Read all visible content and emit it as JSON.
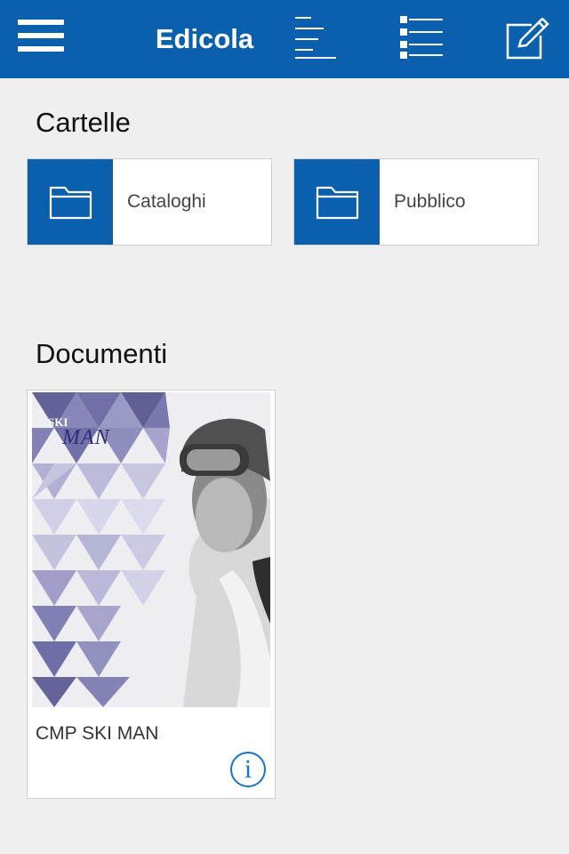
{
  "header": {
    "title": "Edicola",
    "menu_icon": "hamburger-menu-icon",
    "align_icon": "text-align-icon",
    "list_icon": "list-view-icon",
    "compose_icon": "compose-edit-icon",
    "bar_color": "#0a60ac"
  },
  "folders": {
    "section_title": "Cartelle",
    "items": [
      {
        "label": "Cataloghi",
        "icon": "folder-icon"
      },
      {
        "label": "Pubblico",
        "icon": "folder-icon"
      }
    ]
  },
  "documents": {
    "section_title": "Documenti",
    "items": [
      {
        "title": "CMP SKI MAN",
        "cover_text_top": "SKI",
        "cover_text_bottom": "MAN",
        "info_icon": "info-icon",
        "info_glyph": "i"
      }
    ]
  }
}
